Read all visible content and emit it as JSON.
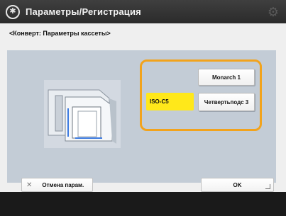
{
  "titlebar": {
    "title": "Параметры/Регистрация",
    "app_icon": "settings-register-icon",
    "gear_icon": "gear-icon"
  },
  "breadcrumb": "<Конверт: Параметры кассеты>",
  "options": {
    "selected": "ISO-C5",
    "monarch": "Monarch 1",
    "other": "Четвертьподс 3"
  },
  "footer": {
    "cancel_label": "Отмена парам.",
    "ok_label": "OK"
  },
  "colors": {
    "accent": "#f2a31c",
    "selected": "#ffe81a"
  }
}
